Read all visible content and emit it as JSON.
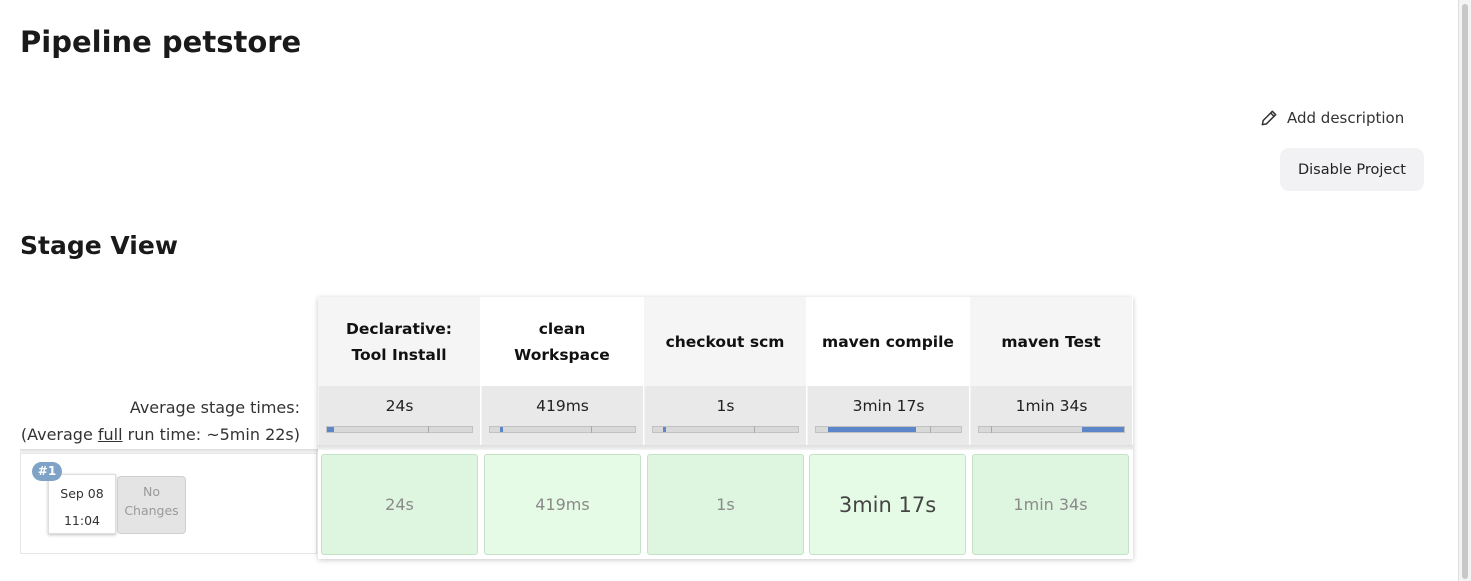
{
  "page": {
    "title": "Pipeline petstore",
    "add_description_label": "Add description",
    "disable_project_label": "Disable Project",
    "stage_view_title": "Stage View"
  },
  "stage_view": {
    "average_label": "Average stage times:",
    "full_run_prefix": "(Average ",
    "full_run_link": "full",
    "full_run_suffix": " run time: ~5min 22s)",
    "stages": [
      {
        "name": "Declarative: Tool Install",
        "avg_time": "24s",
        "run_time": "24s",
        "avg_fraction": 0.05
      },
      {
        "name": "clean Workspace",
        "avg_time": "419ms",
        "run_time": "419ms",
        "avg_fraction": 0.01
      },
      {
        "name": "checkout scm",
        "avg_time": "1s",
        "run_time": "1s",
        "avg_fraction": 0.01
      },
      {
        "name": "maven compile",
        "avg_time": "3min 17s",
        "run_time": "3min 17s",
        "avg_fraction": 0.61
      },
      {
        "name": "maven Test",
        "avg_time": "1min 34s",
        "run_time": "1min 34s",
        "avg_fraction": 0.29
      }
    ],
    "runs": [
      {
        "badge": "#1",
        "date": "Sep 08",
        "time": "11:04",
        "changes": "No Changes"
      }
    ]
  },
  "colors": {
    "success_cell": "#def5df",
    "success_cell_highlight": "#e5fbe5",
    "avg_bar": "#5b86c7",
    "build_badge": "#7fa3c7"
  },
  "icons": {
    "add_description": "pencil-icon"
  }
}
